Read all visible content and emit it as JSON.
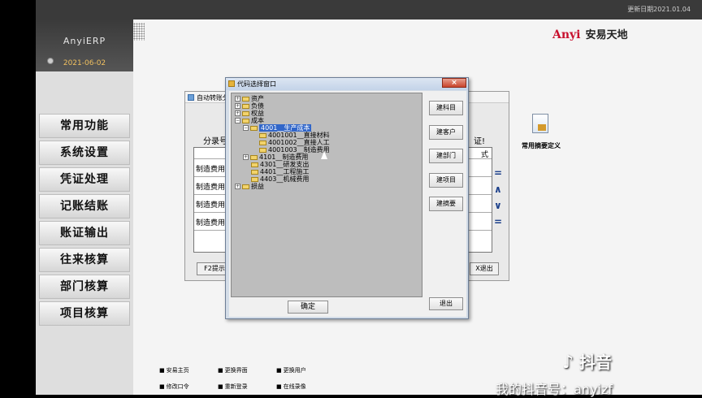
{
  "topbar": {
    "update_date": "更新日期2021.01.04"
  },
  "sidebar": {
    "app_name": "AnyiERP",
    "date": "2021-06-02",
    "items": [
      {
        "label": "常用功能"
      },
      {
        "label": "系统设置"
      },
      {
        "label": "凭证处理"
      },
      {
        "label": "记账结账"
      },
      {
        "label": "账证输出"
      },
      {
        "label": "往来核算"
      },
      {
        "label": "部门核算"
      },
      {
        "label": "项目核算"
      }
    ]
  },
  "brand": {
    "latin": "Anyi",
    "chinese": "安易天地"
  },
  "back_window": {
    "title": "自动转账分",
    "col_label": "分录号",
    "col_label2": "证!",
    "col_header_right": "式",
    "rows": [
      "制造费用",
      "制造费用",
      "制造费用",
      "制造费用"
    ],
    "f2_label": "F2提示",
    "exit_label": "X退出"
  },
  "dialog": {
    "title": "代码选择窗口",
    "tree": [
      {
        "code": "",
        "label": "资产",
        "level": 0,
        "expanded": false
      },
      {
        "code": "",
        "label": "负债",
        "level": 0,
        "expanded": false
      },
      {
        "code": "",
        "label": "权益",
        "level": 0,
        "expanded": false
      },
      {
        "code": "",
        "label": "成本",
        "level": 0,
        "expanded": true
      },
      {
        "code": "4001",
        "label": "4001__生产成本",
        "level": 1,
        "expanded": true,
        "selected": true
      },
      {
        "code": "4001001",
        "label": "4001001__直接材料",
        "level": 2
      },
      {
        "code": "4001002",
        "label": "4001002__直接人工",
        "level": 2
      },
      {
        "code": "4001003",
        "label": "4001003__制造费用",
        "level": 2
      },
      {
        "code": "4101",
        "label": "4101__制造费用",
        "level": 1,
        "expanded": false
      },
      {
        "code": "4301",
        "label": "4301__研发支出",
        "level": 1
      },
      {
        "code": "4401",
        "label": "4401__工程施工",
        "level": 1
      },
      {
        "code": "4403",
        "label": "4403__机械费用",
        "level": 1
      },
      {
        "code": "",
        "label": "损益",
        "level": 0,
        "expanded": false
      }
    ],
    "buttons": [
      "建科目",
      "建客户",
      "建部门",
      "建项目",
      "建摘要"
    ],
    "ok_label": "确定",
    "quit_label": "退出",
    "close_label": "×"
  },
  "desktop_icon": {
    "label": "常用摘要定义"
  },
  "bottom_links": [
    {
      "label": "安易主页"
    },
    {
      "label": "更换界面"
    },
    {
      "label": "更换用户"
    },
    {
      "label": "修改口令"
    },
    {
      "label": "重新登录"
    },
    {
      "label": "在线录像"
    }
  ],
  "overlay": {
    "tiktok": "抖音",
    "watermark": "我的抖音号：anyizf"
  }
}
